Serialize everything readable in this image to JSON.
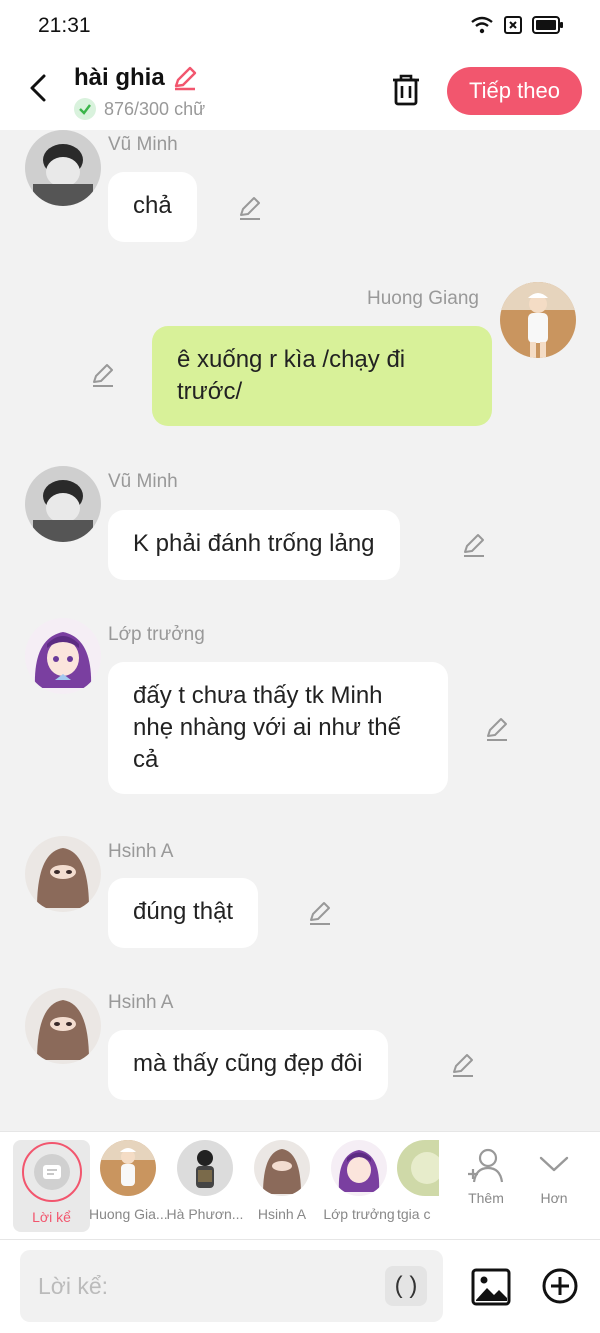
{
  "status": {
    "time": "21:31"
  },
  "header": {
    "title": "hài ghia",
    "word_count": "876/300 chữ",
    "next_label": "Tiếp theo"
  },
  "messages": [
    {
      "name": "Vũ Minh",
      "text": "chả"
    },
    {
      "name": "Huong Giang",
      "text": "ê xuống r kìa /chạy đi trước/"
    },
    {
      "name": "Vũ Minh",
      "text": "K phải đánh trống lảng"
    },
    {
      "name": "Lớp trưởng",
      "text": "đấy t chưa thấy tk Minh nhẹ nhàng với ai như thế cả"
    },
    {
      "name": "Hsinh A",
      "text": "đúng thật"
    },
    {
      "name": "Hsinh A",
      "text": "mà thấy cũng đẹp đôi"
    }
  ],
  "picker": {
    "narrator": "Lời kể",
    "characters": [
      "Huong Gia...",
      "Hà Phươn...",
      "Hsinh A",
      "Lớp trưởng",
      "tgia c"
    ],
    "more_label": "Thêm",
    "expand_label": "Hơn"
  },
  "input": {
    "placeholder": "Lời kể:",
    "paren": "( )"
  },
  "colors": {
    "accent": "#f2566e",
    "green_bubble": "#d8f199",
    "background": "#f2f2f2"
  }
}
